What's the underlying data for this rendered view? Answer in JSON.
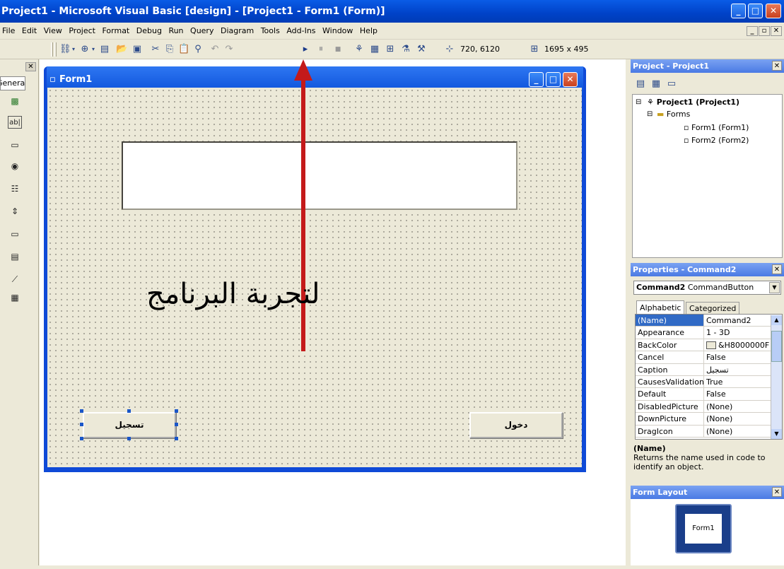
{
  "window": {
    "title": "Project1 - Microsoft Visual Basic [design] - [Project1 - Form1 (Form)]"
  },
  "menu": [
    "File",
    "Edit",
    "View",
    "Project",
    "Format",
    "Debug",
    "Run",
    "Query",
    "Diagram",
    "Tools",
    "Add-Ins",
    "Window",
    "Help"
  ],
  "toolbar": {
    "position": "720, 6120",
    "size": "1695 x 495"
  },
  "toolbox": {
    "tab": "General"
  },
  "form": {
    "title": "Form1",
    "caption_text": "لتجربة البرنامج",
    "buttons": {
      "register": "تسجيل",
      "login": "دخول"
    }
  },
  "project": {
    "title": "Project - Project1",
    "root": "Project1 (Project1)",
    "folder": "Forms",
    "items": [
      "Form1 (Form1)",
      "Form2 (Form2)"
    ]
  },
  "properties": {
    "title": "Properties - Command2",
    "object_name": "Command2",
    "object_type": "CommandButton",
    "tabs": [
      "Alphabetic",
      "Categorized"
    ],
    "rows": [
      {
        "name": "(Name)",
        "value": "Command2"
      },
      {
        "name": "Appearance",
        "value": "1 - 3D"
      },
      {
        "name": "BackColor",
        "value": "&H8000000F"
      },
      {
        "name": "Cancel",
        "value": "False"
      },
      {
        "name": "Caption",
        "value": "تسجيل"
      },
      {
        "name": "CausesValidation",
        "value": "True"
      },
      {
        "name": "Default",
        "value": "False"
      },
      {
        "name": "DisabledPicture",
        "value": "(None)"
      },
      {
        "name": "DownPicture",
        "value": "(None)"
      },
      {
        "name": "DragIcon",
        "value": "(None)"
      }
    ],
    "desc_title": "(Name)",
    "desc_text": "Returns the name used in code to identify an object."
  },
  "layout": {
    "title": "Form Layout",
    "form_label": "Form1"
  },
  "colors": {
    "titlebar": "#0a5ce6",
    "arrow": "#c41a1a",
    "selection": "#316ac5"
  }
}
